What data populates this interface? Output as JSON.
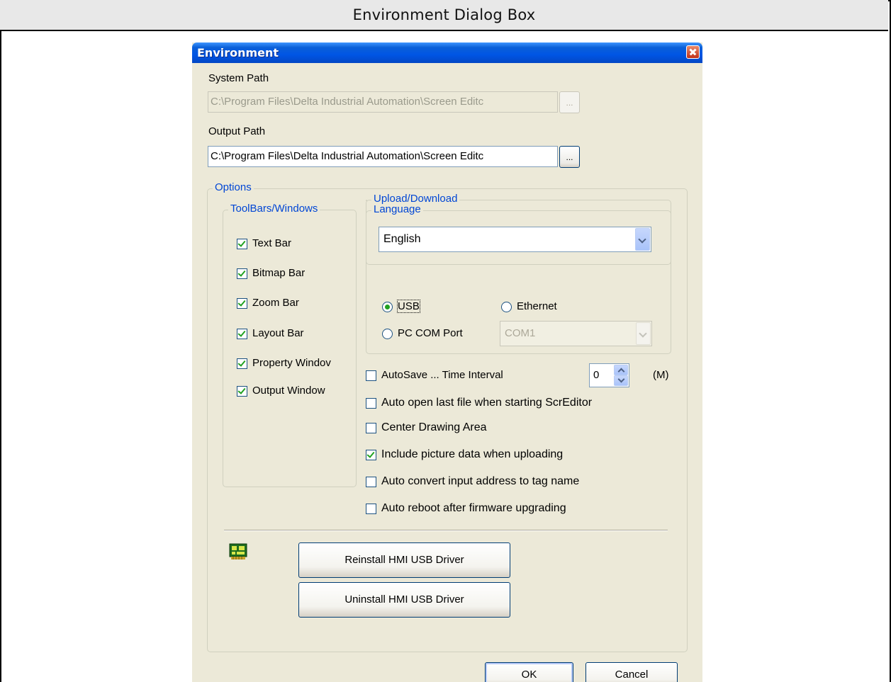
{
  "document": {
    "header": "Environment Dialog Box"
  },
  "dialog": {
    "title": "Environment",
    "system_path": {
      "label": "System Path",
      "value": "C:\\Program Files\\Delta Industrial Automation\\Screen Editc",
      "browse_label": "..."
    },
    "output_path": {
      "label": "Output Path",
      "value": "C:\\Program Files\\Delta Industrial Automation\\Screen Editc",
      "browse_label": "..."
    },
    "options": {
      "title": "Options",
      "toolbars": {
        "title": "ToolBars/Windows",
        "items": [
          {
            "label": "Text Bar",
            "checked": true
          },
          {
            "label": "Bitmap Bar",
            "checked": true
          },
          {
            "label": "Zoom Bar",
            "checked": true
          },
          {
            "label": "Layout Bar",
            "checked": true
          },
          {
            "label": "Property Windov",
            "checked": true
          },
          {
            "label": "Output Window",
            "checked": true
          }
        ]
      },
      "language": {
        "title": "Language",
        "selected": "English"
      },
      "upload_download": {
        "title": "Upload/Download",
        "usb_label": "USB",
        "ethernet_label": "Ethernet",
        "pc_com_label": "PC COM Port",
        "com_port": "COM1",
        "selected": "USB"
      },
      "autosave": {
        "label": "AutoSave ... Time Interval",
        "checked": false,
        "interval_value": "0",
        "unit": "(M)"
      },
      "checkboxes": [
        {
          "label": "Auto open last file when starting ScrEditor",
          "checked": false
        },
        {
          "label": "Center Drawing Area",
          "checked": false
        },
        {
          "label": "Include picture data when uploading",
          "checked": true
        },
        {
          "label": "Auto convert input address to tag name",
          "checked": false
        },
        {
          "label": "Auto reboot after firmware upgrading",
          "checked": false
        }
      ],
      "driver_icon": "usb-driver-icon",
      "reinstall_label": "Reinstall HMI USB Driver",
      "uninstall_label": "Uninstall HMI USB Driver"
    },
    "ok_label": "OK",
    "cancel_label": "Cancel"
  }
}
